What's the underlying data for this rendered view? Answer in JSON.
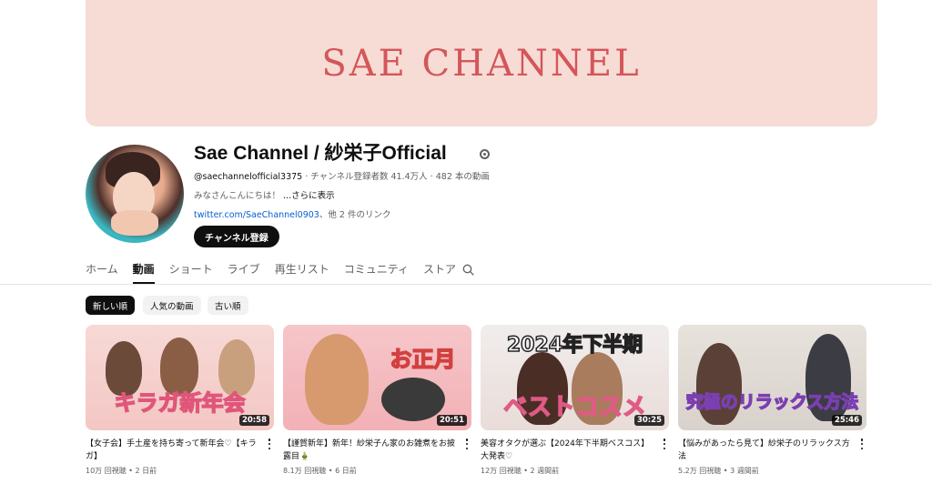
{
  "banner": {
    "text": "SAE CHANNEL"
  },
  "channel": {
    "name": "Sae Channel / 紗栄子Official",
    "handle": "@saechannelofficial3375",
    "stats": " · チャンネル登録者数 41.4万人 · 482 本の動画",
    "description": "みなさんこんにちは！",
    "more_label": " ...さらに表示",
    "link_url": "twitter.com/SaeChannel0903",
    "link_more": "、他 2 件のリンク",
    "subscribe_label": "チャンネル登録"
  },
  "tabs": [
    {
      "label": "ホーム"
    },
    {
      "label": "動画"
    },
    {
      "label": "ショート"
    },
    {
      "label": "ライブ"
    },
    {
      "label": "再生リスト"
    },
    {
      "label": "コミュニティ"
    },
    {
      "label": "ストア"
    }
  ],
  "active_tab": "動画",
  "chips": [
    {
      "label": "新しい順"
    },
    {
      "label": "人気の動画"
    },
    {
      "label": "古い順"
    }
  ],
  "videos": [
    {
      "thumb_text": "キラガ新年会",
      "duration": "20:58",
      "title": "【女子会】手土産を持ち寄って新年会♡【キラガ】",
      "meta": "10万 回視聴 • 2 日前"
    },
    {
      "thumb_text": "お正月",
      "duration": "20:51",
      "title": "【謹賀新年】新年！紗栄子ん家のお雑煮をお披露目🎍",
      "meta": "8.1万 回視聴 • 6 日前"
    },
    {
      "thumb_text": "2024年下半期",
      "thumb_text2": "ベストコスメ",
      "duration": "30:25",
      "title": "美容オタクが選ぶ【2024年下半期ベスコス】大発表♡",
      "meta": "12万 回視聴 • 2 週間前"
    },
    {
      "thumb_text": "究極のリラックス方法",
      "duration": "25:46",
      "title": "【悩みがあったら見て】紗栄子のリラックス方法",
      "meta": "5.2万 回視聴 • 3 週間前"
    }
  ],
  "colors": {
    "banner_bg": "#f6dcd5",
    "banner_text": "#d4565a",
    "link": "#065fd4"
  }
}
